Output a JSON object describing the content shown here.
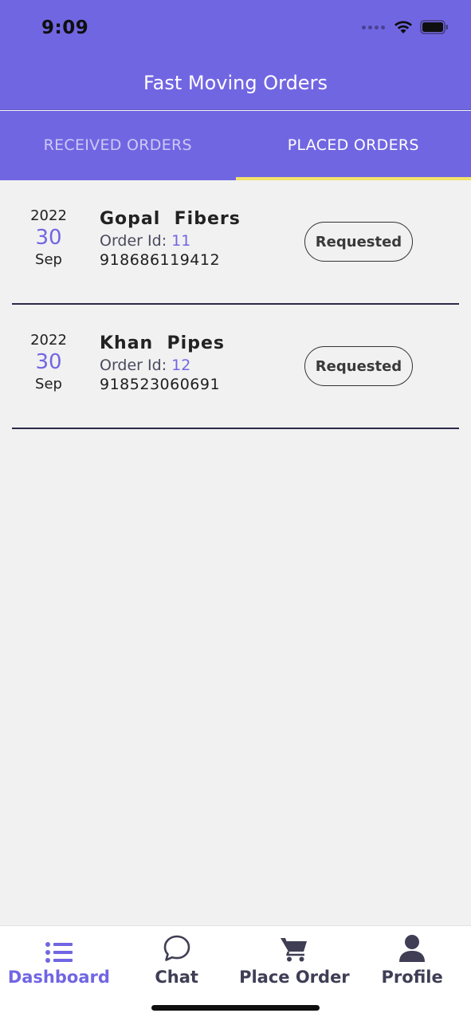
{
  "status_bar": {
    "time": "9:09"
  },
  "header": {
    "title": "Fast Moving Orders"
  },
  "tabs": [
    {
      "label": "RECEIVED ORDERS",
      "active": false
    },
    {
      "label": "PLACED ORDERS",
      "active": true
    }
  ],
  "orders": [
    {
      "year": "2022",
      "day": "30",
      "month": "Sep",
      "name": "Gopal  Fibers",
      "order_id_label": "Order Id:",
      "order_id": "11",
      "phone": "918686119412",
      "status": "Requested"
    },
    {
      "year": "2022",
      "day": "30",
      "month": "Sep",
      "name": "Khan  Pipes",
      "order_id_label": "Order Id:",
      "order_id": "12",
      "phone": "918523060691",
      "status": "Requested"
    }
  ],
  "bottom_nav": [
    {
      "label": "Dashboard",
      "icon": "list-icon",
      "active": true
    },
    {
      "label": "Chat",
      "icon": "chat-bubble-icon",
      "active": false
    },
    {
      "label": "Place Order",
      "icon": "cart-icon",
      "active": false
    },
    {
      "label": "Profile",
      "icon": "person-icon",
      "active": false
    }
  ],
  "colors": {
    "primary": "#7166e2",
    "tab_indicator": "#f2e36a",
    "background": "#f1f1f1",
    "divider": "#2c2a4a"
  }
}
